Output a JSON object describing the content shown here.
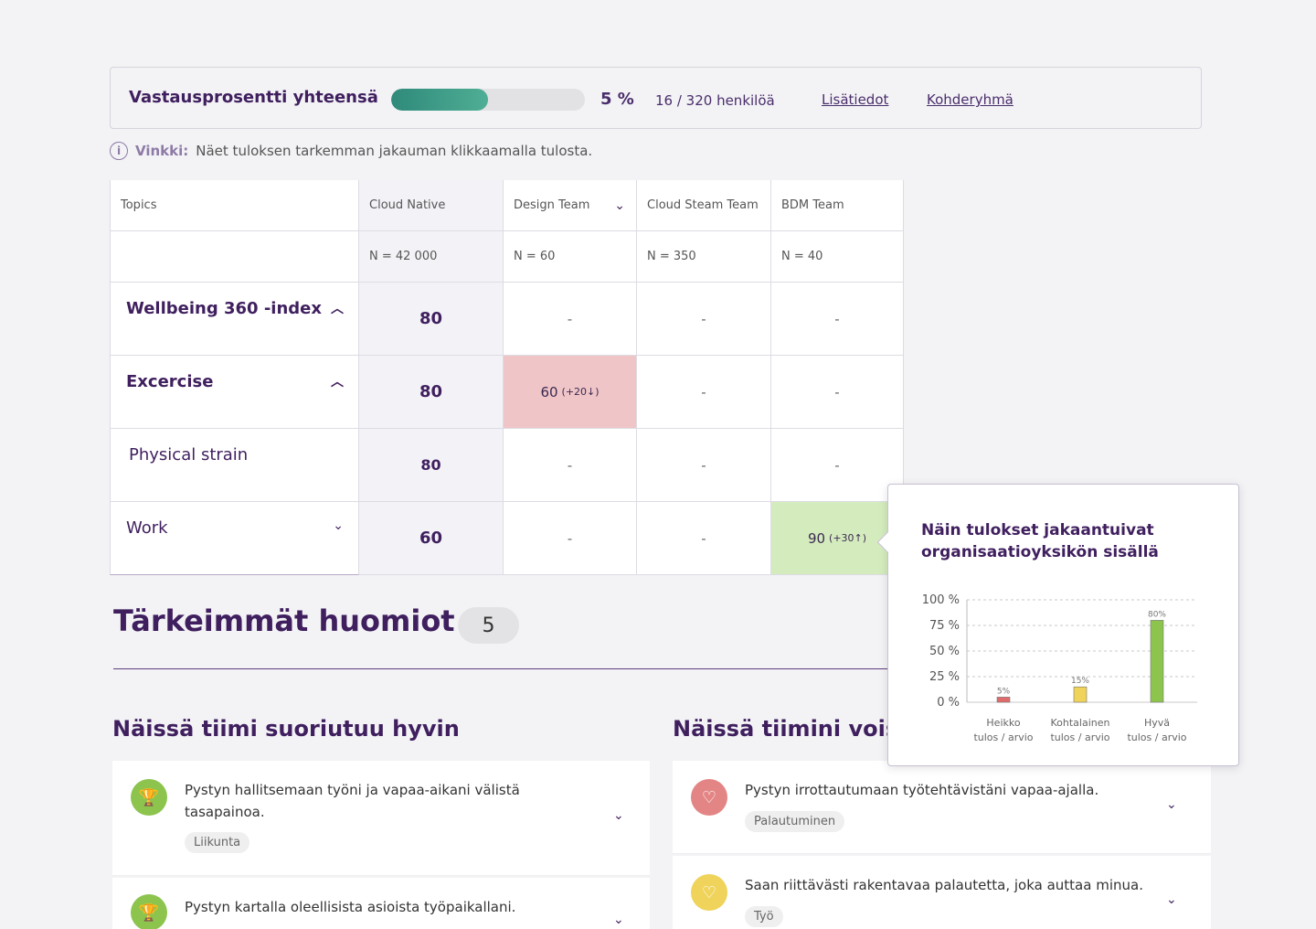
{
  "response": {
    "title": "Vastausprosentti yhteensä",
    "progress_fraction": 0.5,
    "percent_label": "5 %",
    "count_label": "16 / 320 henkilöä",
    "link_details": "Lisätiedot",
    "link_target": "Kohderyhmä"
  },
  "hint": {
    "icon": "info-icon",
    "label": "Vinkki:",
    "text": "Näet tuloksen tarkemman jakauman klikkaamalla tulosta."
  },
  "table": {
    "topics_header": "Topics",
    "columns": [
      {
        "name": "Cloud Native",
        "n": "N = 42 000"
      },
      {
        "name": "Design Team",
        "n": "N = 60"
      },
      {
        "name": "Cloud Steam Team",
        "n": "N = 350"
      },
      {
        "name": "BDM Team",
        "n": "N = 40"
      }
    ],
    "rows": [
      {
        "topic": "Wellbeing 360 -index",
        "values": [
          "80",
          "-",
          "-",
          "-"
        ]
      },
      {
        "topic": "Excercise",
        "values": [
          "80",
          "60",
          "-",
          "-"
        ],
        "delta_design": "(+20↓)"
      },
      {
        "topic": "Physical strain",
        "values": [
          "80",
          "-",
          "-",
          "-"
        ]
      },
      {
        "topic": "Work",
        "values": [
          "60",
          "-",
          "-",
          "90"
        ],
        "delta_bdm": "(+30↑)"
      }
    ]
  },
  "highlights": {
    "title": "Tärkeimmät huomiot",
    "count": "5",
    "good_title": "Näissä tiimi suoriutuu hyvin",
    "improve_title": "Näissä tiimini voisi",
    "good_items": [
      {
        "text": "Pystyn hallitsemaan työni ja vapaa-aikani välistä tasapainoa.",
        "tag": "Liikunta",
        "icon": "trophy-icon"
      },
      {
        "text": "Pystyn kartalla oleellisista asioista työpaikallani.",
        "icon": "trophy-icon"
      }
    ],
    "improve_items": [
      {
        "text": "Pystyn irrottautumaan työtehtävistäni vapaa-ajalla.",
        "tag": "Palautuminen",
        "icon": "hand-heart-icon"
      },
      {
        "text": "Saan riittävästi rakentavaa palautetta, joka auttaa minua.",
        "tag": "Työ",
        "icon": "hand-heart-icon"
      }
    ]
  },
  "popup": {
    "title": "Näin tulokset jakaantuivat organisaatioyksikön sisällä"
  },
  "chart_data": {
    "type": "bar",
    "categories": [
      "Heikko tulos / arvio",
      "Kohtalainen tulos / arvio",
      "Hyvä tulos / arvio"
    ],
    "values": [
      5,
      15,
      80
    ],
    "value_labels": [
      "5%",
      "15%",
      "80%"
    ],
    "colors": [
      "#e06b6b",
      "#efd35a",
      "#8cc44e"
    ],
    "ylim": [
      0,
      100
    ],
    "yticks": [
      "100 %",
      "75 %",
      "50 %",
      "25 %",
      "0 %"
    ],
    "grid": true
  }
}
